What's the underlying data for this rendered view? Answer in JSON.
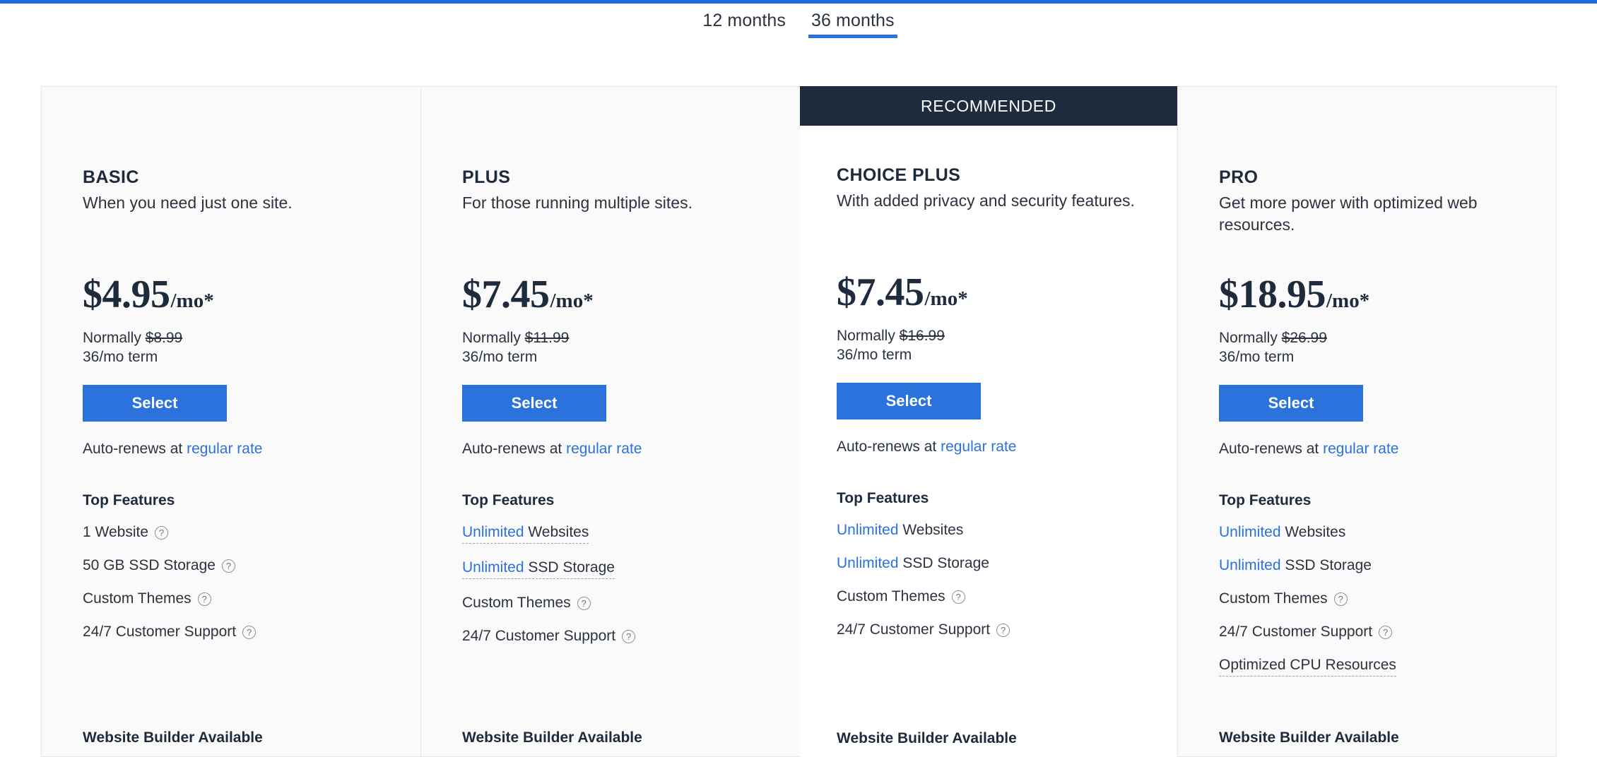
{
  "theme": {
    "accent_blue": "#2b72dc",
    "top_bar_blue": "#1a6cda",
    "dark_navy": "#1d2b3c",
    "card_bg": "#fafafa",
    "featured_card_bg": "#ffffff"
  },
  "tabs": {
    "items": [
      {
        "label": "12 months",
        "active": false
      },
      {
        "label": "36 months",
        "active": true
      }
    ]
  },
  "labels": {
    "recommended": "RECOMMENDED",
    "select": "Select",
    "top_features": "Top Features",
    "auto_renews_prefix": "Auto-renews at ",
    "regular_rate": "regular rate",
    "website_builder": "Website Builder Available",
    "help_icon": "question-mark-icon"
  },
  "plans": [
    {
      "name": "BASIC",
      "description": "When you need just one site.",
      "price": "$4.95",
      "per": "/mo*",
      "normally_prefix": "Normally ",
      "normally_price": "$8.99",
      "term": "36/mo term",
      "recommended": false,
      "features": [
        {
          "highlight": "",
          "text": "1 Website",
          "help": true,
          "dotted": false
        },
        {
          "highlight": "",
          "text": "50 GB SSD Storage",
          "help": true,
          "dotted": false
        },
        {
          "highlight": "",
          "text": "Custom Themes",
          "help": true,
          "dotted": false
        },
        {
          "highlight": "",
          "text": "24/7 Customer Support",
          "help": true,
          "dotted": false
        }
      ]
    },
    {
      "name": "PLUS",
      "description": "For those running multiple sites.",
      "price": "$7.45",
      "per": "/mo*",
      "normally_prefix": "Normally ",
      "normally_price": "$11.99",
      "term": "36/mo term",
      "recommended": false,
      "features": [
        {
          "highlight": "Unlimited",
          "text": " Websites",
          "help": false,
          "dotted": true
        },
        {
          "highlight": "Unlimited",
          "text": " SSD Storage",
          "help": false,
          "dotted": true
        },
        {
          "highlight": "",
          "text": "Custom Themes",
          "help": true,
          "dotted": false
        },
        {
          "highlight": "",
          "text": "24/7 Customer Support",
          "help": true,
          "dotted": false
        }
      ]
    },
    {
      "name": "CHOICE PLUS",
      "description": "With added privacy and security features.",
      "price": "$7.45",
      "per": "/mo*",
      "normally_prefix": "Normally ",
      "normally_price": "$16.99",
      "term": "36/mo term",
      "recommended": true,
      "features": [
        {
          "highlight": "Unlimited",
          "text": " Websites",
          "help": false,
          "dotted": false
        },
        {
          "highlight": "Unlimited",
          "text": " SSD Storage",
          "help": false,
          "dotted": false
        },
        {
          "highlight": "",
          "text": "Custom Themes",
          "help": true,
          "dotted": false
        },
        {
          "highlight": "",
          "text": "24/7 Customer Support",
          "help": true,
          "dotted": false
        }
      ]
    },
    {
      "name": "PRO",
      "description": "Get more power with optimized web resources.",
      "price": "$18.95",
      "per": "/mo*",
      "normally_prefix": "Normally ",
      "normally_price": "$26.99",
      "term": "36/mo term",
      "recommended": false,
      "features": [
        {
          "highlight": "Unlimited",
          "text": " Websites",
          "help": false,
          "dotted": false
        },
        {
          "highlight": "Unlimited",
          "text": " SSD Storage",
          "help": false,
          "dotted": false
        },
        {
          "highlight": "",
          "text": "Custom Themes",
          "help": true,
          "dotted": false
        },
        {
          "highlight": "",
          "text": "24/7 Customer Support",
          "help": true,
          "dotted": false
        },
        {
          "highlight": "",
          "text": "Optimized CPU Resources",
          "help": false,
          "dotted": true
        }
      ]
    }
  ]
}
